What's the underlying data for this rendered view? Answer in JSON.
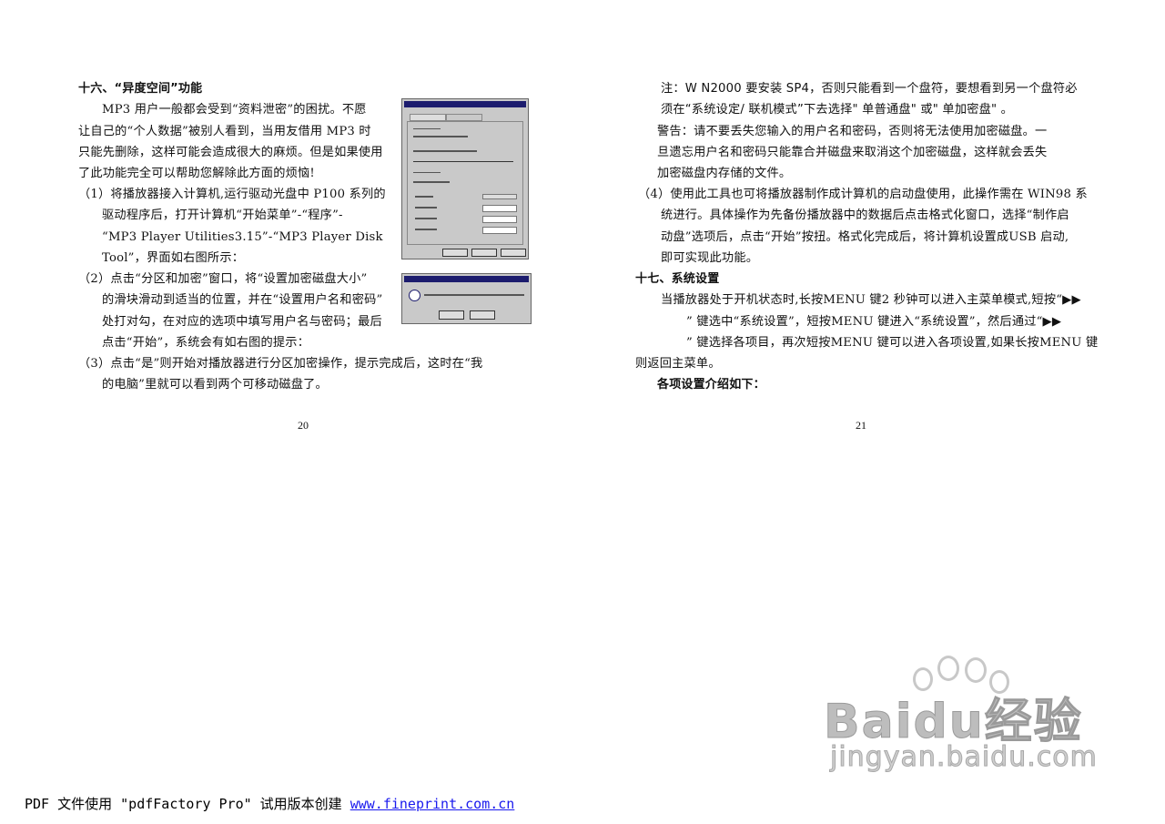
{
  "left_page": {
    "heading": "十六、“异度空间”功能",
    "lines": [
      "MP3 用户一般都会受到“资料泄密”的困扰。不愿",
      "让自己的“个人数据”被别人看到，当用友借用 MP3 时",
      "只能先删除，这样可能会造成很大的麻烦。但是如果使用",
      "了此功能完全可以帮助您解除此方面的烦恼!",
      "（1）将播放器接入计算机,运行驱动光盘中 P100 系列的",
      "驱动程序后，打开计算机“开始菜单”-“程序”-",
      "“MP3 Player Utilities3.15”-“MP3 Player Disk",
      "Tool”，界面如右图所示：",
      "（2）点击“分区和加密”窗口，将“设置加密磁盘大小”",
      "的滑块滑动到适当的位置，并在“设置用户名和密码”",
      "处打对勾，在对应的选项中填写用户名与密码；最后",
      "点击“开始”，系统会有如右图的提示：",
      "（3）点击“是”则开始对播放器进行分区加密操作，提示完成后，这时在“我",
      "的电脑”里就可以看到两个可移动磁盘了。"
    ],
    "page_number": "20"
  },
  "right_page": {
    "lines": [
      "注：W N2000 要安装 SP4，否则只能看到一个盘符，要想看到另一个盘符必",
      "须在“系统设定/ 联机模式”下去选择\" 单普通盘\" 或\" 单加密盘\" 。",
      "警告：请不要丢失您输入的用户名和密码，否则将无法使用加密磁盘。一",
      "旦遗忘用户名和密码只能靠合并磁盘来取消这个加密磁盘，这样就会丢失",
      "加密磁盘内存储的文件。",
      "（4）使用此工具也可将播放器制作成计算机的启动盘使用，此操作需在 WIN98 系",
      "统进行。具体操作为先备份播放器中的数据后点击格式化窗口，选择“制作启",
      "动盘”选项后，点击“开始”按扭。格式化完成后，将计算机设置成USB 启动,",
      "即可实现此功能。",
      "十七、系统设置",
      "当播放器处于开机状态时,长按MENU 键2 秒钟可以进入主菜单模式,短按“▶▶",
      "” 键选中“系统设置”，短按MENU 键进入“系统设置”，然后通过“▶▶",
      "” 键选择各项目，再次短按MENU 键可以进入各项设置,如果长按MENU 键",
      "则返回主菜单。",
      "各项设置介绍如下："
    ],
    "page_number": "21"
  },
  "footer": {
    "text": "PDF 文件使用 \"pdfFactory Pro\" 试用版本创建 ",
    "link": "www.fineprint.com.cn"
  },
  "watermark": {
    "main": "Baidu经验",
    "sub": "jingyan.baidu.com"
  }
}
